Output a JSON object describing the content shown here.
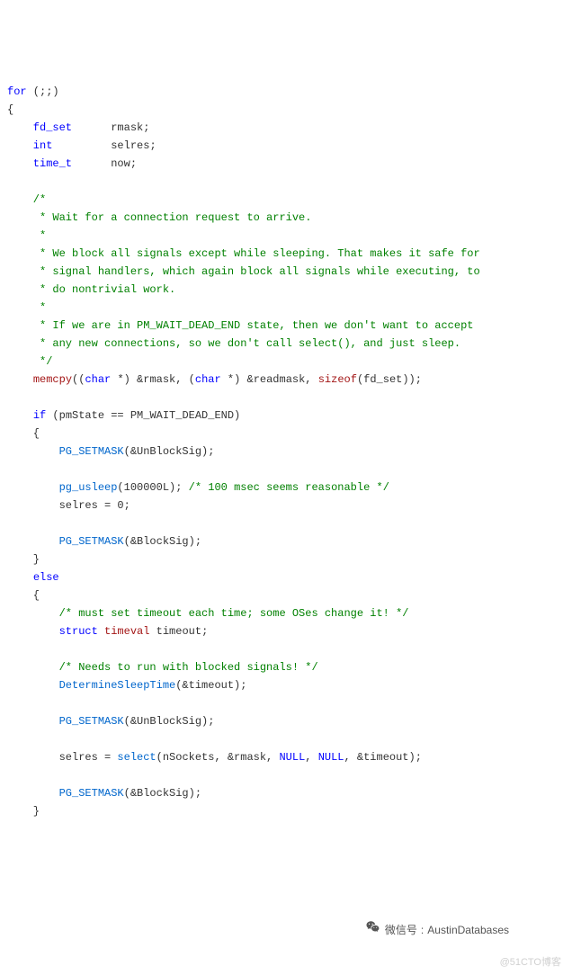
{
  "code": {
    "l1": {
      "a": "for",
      "b": " (;;)"
    },
    "l2": "{",
    "l3": {
      "a": "    fd_set",
      "b": "      rmask;"
    },
    "l4": {
      "a": "    int",
      "b": "         selres;"
    },
    "l5": {
      "a": "    time_t",
      "b": "      now;"
    },
    "l6": "",
    "l7": "    /*",
    "l8": "     * Wait for a connection request to arrive.",
    "l9": "     *",
    "l10": "     * We block all signals except while sleeping. That makes it safe for",
    "l11": "     * signal handlers, which again block all signals while executing, to",
    "l12": "     * do nontrivial work.",
    "l13": "     *",
    "l14": "     * If we are in PM_WAIT_DEAD_END state, then we don't want to accept",
    "l15": "     * any new connections, so we don't call select(), and just sleep.",
    "l16": "     */",
    "l17": {
      "a": "    ",
      "f": "memcpy",
      "b": "((",
      "kw1": "char",
      "c": " *) &rmask, (",
      "kw2": "char",
      "d": " *) &readmask, ",
      "sz": "sizeof",
      "e": "(fd_set));"
    },
    "l18": "",
    "l19": {
      "a": "    ",
      "kw": "if",
      "b": " (pmState == PM_WAIT_DEAD_END)"
    },
    "l20": "    {",
    "l21": {
      "a": "        ",
      "f": "PG_SETMASK",
      "b": "(&UnBlockSig);"
    },
    "l22": "",
    "l23": {
      "a": "        ",
      "f": "pg_usleep",
      "b": "(",
      "num": "100000L",
      "c": "); ",
      "cmt": "/* 100 msec seems reasonable */"
    },
    "l24": {
      "a": "        selres = ",
      "num": "0",
      "b": ";"
    },
    "l25": "",
    "l26": {
      "a": "        ",
      "f": "PG_SETMASK",
      "b": "(&BlockSig);"
    },
    "l27": "    }",
    "l28": {
      "a": "    ",
      "kw": "else"
    },
    "l29": "    {",
    "l30": {
      "a": "        ",
      "cmt": "/* must set timeout each time; some OSes change it! */"
    },
    "l31": {
      "a": "        ",
      "kw": "struct",
      "b": " ",
      "ty": "timeval",
      "c": " timeout;"
    },
    "l32": "",
    "l33": {
      "a": "        ",
      "cmt": "/* Needs to run with blocked signals! */"
    },
    "l34": {
      "a": "        ",
      "f": "DetermineSleepTime",
      "b": "(&timeout);"
    },
    "l35": "",
    "l36": {
      "a": "        ",
      "f": "PG_SETMASK",
      "b": "(&UnBlockSig);"
    },
    "l37": "",
    "l38": {
      "a": "        selres = ",
      "f": "select",
      "b": "(nSockets, &rmask, ",
      "n1": "NULL",
      "c": ", ",
      "n2": "NULL",
      "d": ", &timeout);"
    },
    "l39": "",
    "l40": {
      "a": "        ",
      "f": "PG_SETMASK",
      "b": "(&BlockSig);"
    },
    "l41": "    }"
  },
  "watermark": {
    "label": "微信号",
    "sep": ":",
    "value": "AustinDatabases",
    "secondary": "@51CTO博客"
  }
}
